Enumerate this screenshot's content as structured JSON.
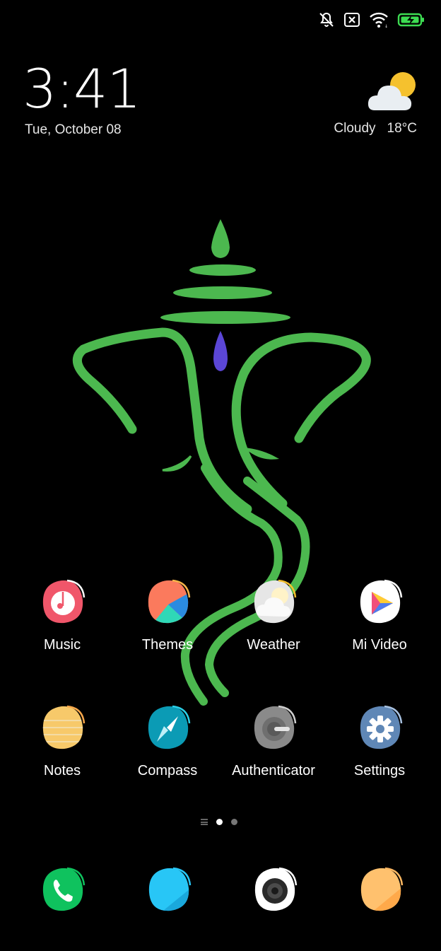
{
  "status_bar": {
    "icons": [
      "notifications-off-icon",
      "no-sim-icon",
      "wifi-icon",
      "battery-charging-icon"
    ],
    "battery_color": "#3ddc52"
  },
  "clock": {
    "time": "3:41",
    "date": "Tue, October 08"
  },
  "weather": {
    "icon": "partly-cloudy-icon",
    "condition": "Cloudy",
    "temperature": "18°C"
  },
  "wallpaper": {
    "subject": "ganesha-line-art",
    "line_color": "#4cb84f",
    "drop_color": "#5b46d6"
  },
  "apps": [
    {
      "label": "Music",
      "icon": "music-icon",
      "color": "#f0566a"
    },
    {
      "label": "Themes",
      "icon": "themes-icon",
      "color": "#fb7a5d"
    },
    {
      "label": "Weather",
      "icon": "weather-icon",
      "color": "#e8e8e8"
    },
    {
      "label": "Mi Video",
      "icon": "mi-video-icon",
      "color": "#ffffff"
    },
    {
      "label": "Notes",
      "icon": "notes-icon",
      "color": "#f7c96a"
    },
    {
      "label": "Compass",
      "icon": "compass-icon",
      "color": "#0b9bb5"
    },
    {
      "label": "Authenticator",
      "icon": "authenticator-icon",
      "color": "#8a8a8a"
    },
    {
      "label": "Settings",
      "icon": "settings-icon",
      "color": "#5f87b6"
    }
  ],
  "pager": {
    "pages": 2,
    "current_page": 1
  },
  "dock": [
    {
      "icon": "phone-icon",
      "color": "#0fc25e"
    },
    {
      "icon": "messages-icon",
      "color": "#28c6f6"
    },
    {
      "icon": "camera-icon",
      "color": "#ffffff"
    },
    {
      "icon": "browser-icon",
      "color": "#ffb862"
    }
  ]
}
